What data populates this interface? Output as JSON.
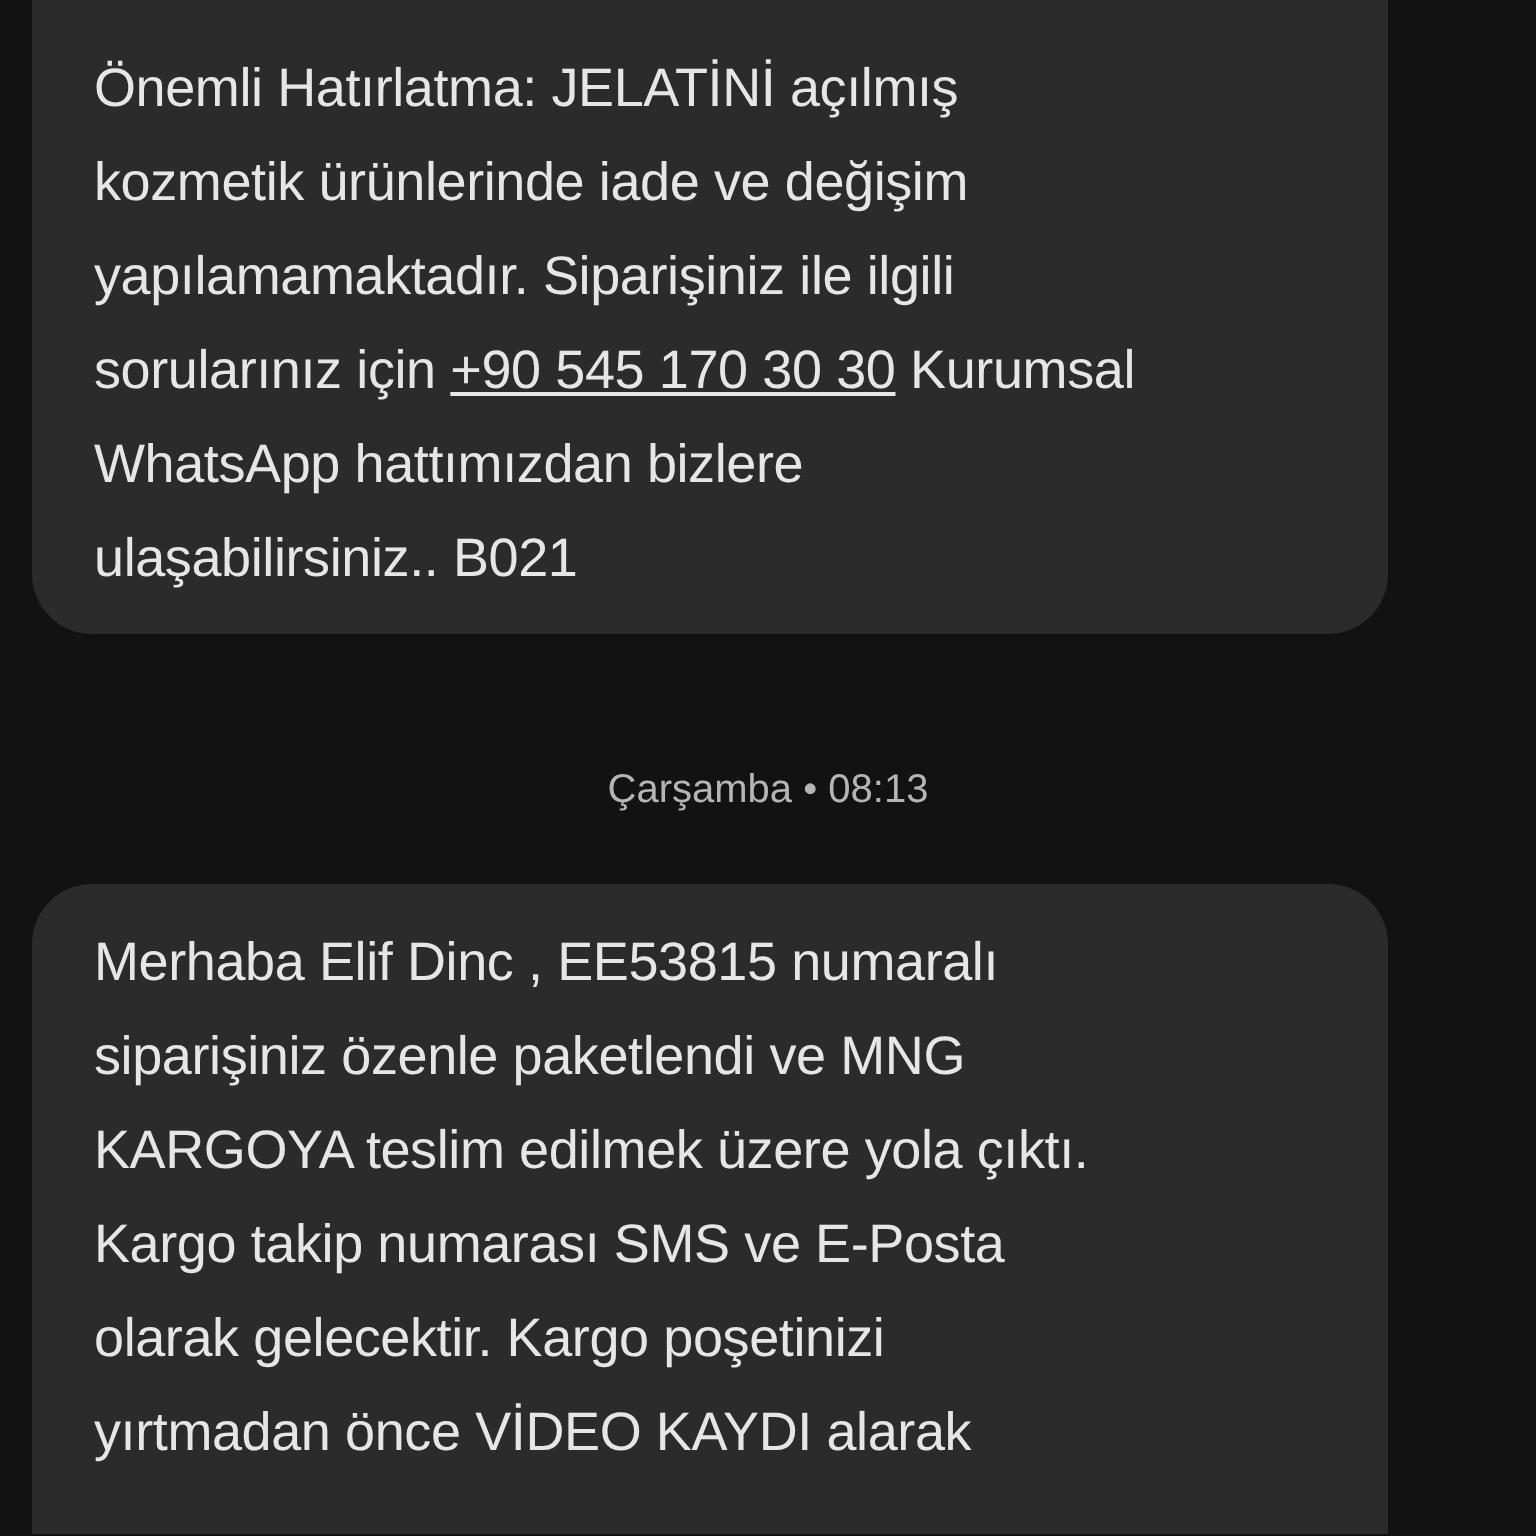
{
  "messages": [
    {
      "kind": "incoming",
      "text_before": "Önemli Hatırlatma: JELATİNİ açılmış\nkozmetik ürünlerinde iade ve değişim\nyapılamamaktadır. Siparişiniz ile ilgili\nsorularınız için ",
      "link": "+90 545 170 30 30",
      "text_after": " Kurumsal\nWhatsApp hattımızdan bizlere\nulaşabilirsiniz.. B021"
    },
    {
      "kind": "timestamp",
      "text": "Çarşamba • 08:13"
    },
    {
      "kind": "incoming",
      "text_before": "Merhaba Elif Dinc , EE53815 numaralı\nsiparişiniz özenle paketlendi ve MNG\nKARGOYA teslim edilmek üzere yola çıktı.\nKargo takip numarası SMS ve E-Posta\nolarak gelecektir. Kargo poşetinizi\nyırtmadan önce VİDEO KAYDI alarak"
    }
  ]
}
